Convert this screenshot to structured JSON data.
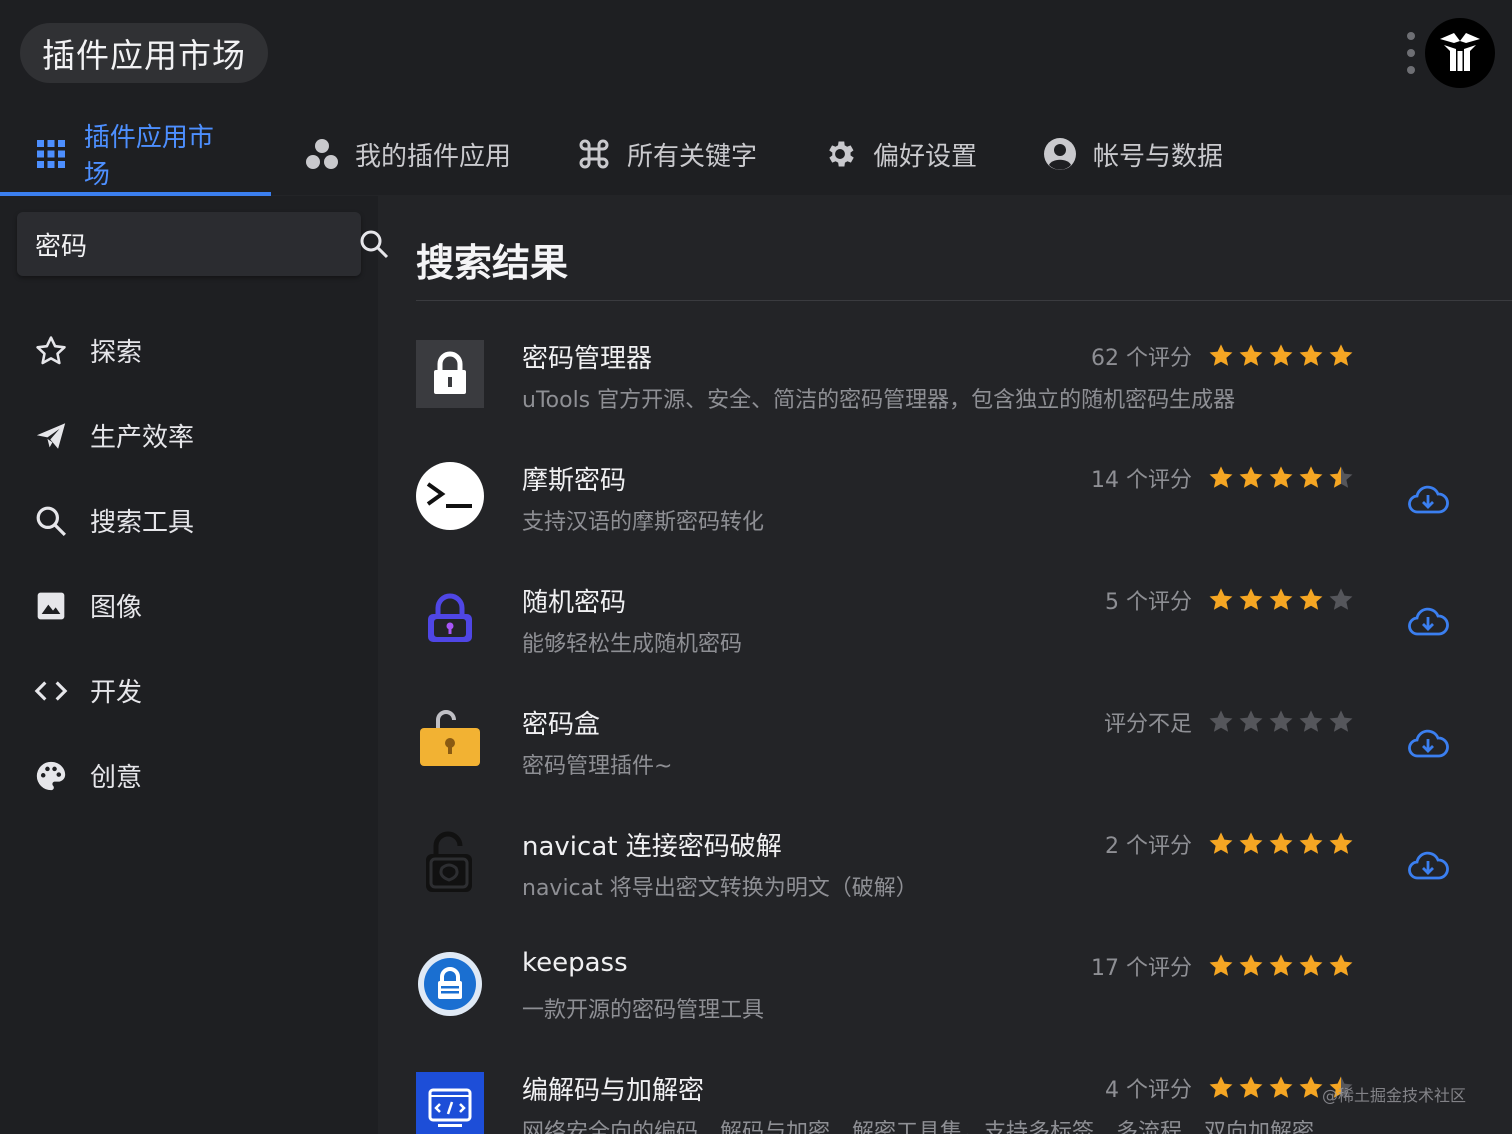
{
  "window": {
    "title": "插件应用市场"
  },
  "tabs": [
    {
      "label": "插件应用市场",
      "icon": "grid-icon",
      "active": true
    },
    {
      "label": "我的插件应用",
      "icon": "plugins-icon",
      "active": false
    },
    {
      "label": "所有关键字",
      "icon": "command-icon",
      "active": false
    },
    {
      "label": "偏好设置",
      "icon": "gear-icon",
      "active": false
    },
    {
      "label": "帐号与数据",
      "icon": "account-icon",
      "active": false
    }
  ],
  "search": {
    "value": "密码"
  },
  "categories": [
    {
      "label": "探索",
      "icon": "star-outline-icon"
    },
    {
      "label": "生产效率",
      "icon": "paper-plane-icon"
    },
    {
      "label": "搜索工具",
      "icon": "search-icon"
    },
    {
      "label": "图像",
      "icon": "image-icon"
    },
    {
      "label": "开发",
      "icon": "code-icon"
    },
    {
      "label": "创意",
      "icon": "palette-icon"
    }
  ],
  "results": {
    "heading": "搜索结果",
    "items": [
      {
        "name": "密码管理器",
        "desc": "uTools 官方开源、安全、简洁的密码管理器，包含独立的随机密码生成器",
        "rating_text": "62 个评分",
        "stars": 5,
        "installed": true
      },
      {
        "name": "摩斯密码",
        "desc": "支持汉语的摩斯密码转化",
        "rating_text": "14 个评分",
        "stars": 4.5,
        "installed": false
      },
      {
        "name": "随机密码",
        "desc": "能够轻松生成随机密码",
        "rating_text": "5 个评分",
        "stars": 4,
        "installed": false
      },
      {
        "name": "密码盒",
        "desc": "密码管理插件~",
        "rating_text": "评分不足",
        "stars": 0,
        "installed": false
      },
      {
        "name": "navicat 连接密码破解",
        "desc": "navicat 将导出密文转换为明文（破解）",
        "rating_text": "2 个评分",
        "stars": 5,
        "installed": false
      },
      {
        "name": "keepass",
        "desc": "一款开源的密码管理工具",
        "rating_text": "17 个评分",
        "stars": 5,
        "installed": true
      },
      {
        "name": "编解码与加解密",
        "desc": "网络安全向的编码、解码与加密、解密工具集，支持多标签、多流程、双向加解密",
        "rating_text": "4 个评分",
        "stars": 4.5,
        "installed": true
      }
    ]
  },
  "watermark": "@稀土掘金技术社区",
  "colors": {
    "accent": "#3b7ff0",
    "star": "#f5a623",
    "star_empty": "#55565b",
    "background": "#232427",
    "sidebar": "#1e1f22"
  }
}
